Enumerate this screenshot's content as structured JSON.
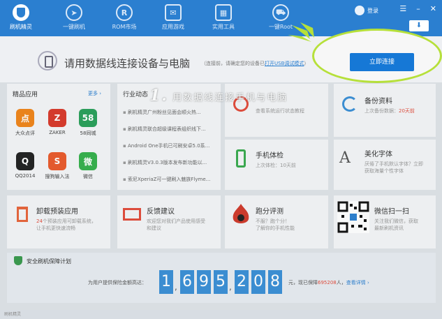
{
  "app": {
    "name": "刷机精灵"
  },
  "nav": [
    {
      "label": "一键刷机",
      "icon": "cursor-icon",
      "glyph": "➤"
    },
    {
      "label": "ROM市场",
      "icon": "rom-icon",
      "glyph": "R"
    },
    {
      "label": "应用游戏",
      "icon": "apps-icon",
      "glyph": "✉"
    },
    {
      "label": "实用工具",
      "icon": "tools-icon",
      "glyph": "▦"
    },
    {
      "label": "一键Root",
      "icon": "root-icon",
      "glyph": "⛟"
    }
  ],
  "header": {
    "login": "登录"
  },
  "connect": {
    "title": "请用数据线连接设备与电脑",
    "sub_prefix": "（连接前，请确定您的设备已",
    "sub_link": "打开USB调试模式",
    "sub_suffix": "）",
    "button": "立即连接"
  },
  "annotation": {
    "num": "1.",
    "text": "用数据线连接手机与电脑"
  },
  "featured_apps": {
    "title": "精品应用",
    "more": "更多 ›",
    "items": [
      {
        "label": "大众点评",
        "color": "#f08519",
        "glyph": "点"
      },
      {
        "label": "ZAKER",
        "color": "#d93a2b",
        "glyph": "Z"
      },
      {
        "label": "58同城",
        "color": "#2aa05a",
        "glyph": "58"
      },
      {
        "label": "QQ2014",
        "color": "#222222",
        "glyph": "Q"
      },
      {
        "label": "搜狗输入法",
        "color": "#ea5a2b",
        "glyph": "S"
      },
      {
        "label": "微信",
        "color": "#36b04b",
        "glyph": "微"
      }
    ]
  },
  "news": {
    "title": "行业动态",
    "items": [
      "刷机精灵广州粉丝见面会顺火热...",
      "刷机精灵联合超级课程表组织线下...",
      "Android One手机已可刷安卓5.0系...",
      "刷机精灵V3.0.3版本发布新功能以...",
      "索尼XperiaZ可一键刷入魅族Flyme..."
    ]
  },
  "features": {
    "checkup": {
      "title": "手机体检",
      "sub": "上次体检：10天前"
    },
    "backup": {
      "title": "备份资料",
      "sub_prefix": "上次备份数据：",
      "sub_value": "20天前"
    },
    "sysinfo": {
      "sub": "查看系统运行状态教程"
    },
    "fonts": {
      "title": "美化字体",
      "sub1": "厌倦了手机默认字体？立即",
      "sub2": "获取海量个性字体"
    },
    "uninstall": {
      "title": "卸载预装应用",
      "sub1_red": "24",
      "sub1": "个预装应用可卸载系统，",
      "sub2": "让手机更快速流畅"
    },
    "feedback": {
      "title": "反馈建议",
      "sub1": "欢迎您对我们产品使用感受",
      "sub2": "和建议"
    },
    "benchmark": {
      "title": "跑分评测",
      "sub1": "不服？跑个分！",
      "sub2": "了解你的手机性能"
    },
    "wechat": {
      "title": "微信扫一扫",
      "sub1": "关注我们微信，获取",
      "sub2": "最新刷机资讯"
    }
  },
  "plan": {
    "title": "安全刷机保障计划",
    "label": "为用户提供保险金额高达：",
    "digits": [
      "1",
      "6",
      "9",
      "5",
      "2",
      "0",
      "8"
    ],
    "after_prefix": "元，现已保障",
    "after_value": "695208",
    "after_suffix": "人，",
    "after_link": "查看详情 ›"
  },
  "status": {
    "text": "刷机精灵"
  }
}
